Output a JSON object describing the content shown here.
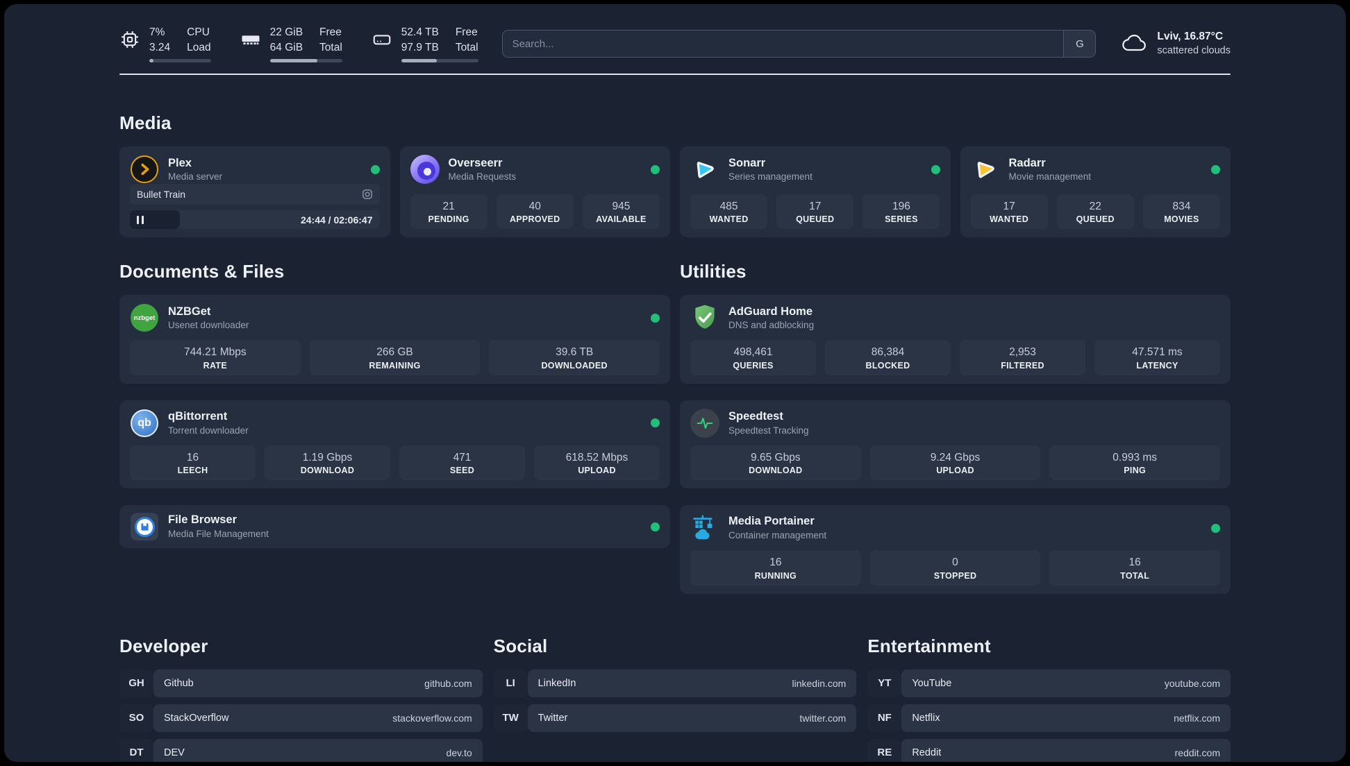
{
  "header": {
    "stats": [
      {
        "id": "cpu",
        "value_top": "7%",
        "value_bottom": "3.24",
        "label_top": "CPU",
        "label_bottom": "Load",
        "progress_percent": 7
      },
      {
        "id": "memory",
        "value_top": "22 GiB",
        "value_bottom": "64 GiB",
        "label_top": "Free",
        "label_bottom": "Total",
        "progress_percent": 66
      },
      {
        "id": "disk",
        "value_top": "52.4 TB",
        "value_bottom": "97.9 TB",
        "label_top": "Free",
        "label_bottom": "Total",
        "progress_percent": 46
      }
    ],
    "search": {
      "placeholder": "Search...",
      "button_label": "G"
    },
    "weather": {
      "location": "Lviv, 16.87°C",
      "condition": "scattered clouds"
    }
  },
  "sections": {
    "media": {
      "title": "Media",
      "plex": {
        "name": "Plex",
        "description": "Media server",
        "status": "online",
        "now_playing": {
          "title": "Bullet Train",
          "state": "paused",
          "time_display": "24:44 / 02:06:47",
          "elapsed": "24:44",
          "duration": "02:06:47",
          "progress_percent": 20
        }
      },
      "overseerr": {
        "name": "Overseerr",
        "description": "Media Requests",
        "status": "online",
        "stats": [
          {
            "value": "21",
            "label": "PENDING"
          },
          {
            "value": "40",
            "label": "APPROVED"
          },
          {
            "value": "945",
            "label": "AVAILABLE"
          }
        ]
      },
      "sonarr": {
        "name": "Sonarr",
        "description": "Series management",
        "status": "online",
        "stats": [
          {
            "value": "485",
            "label": "WANTED"
          },
          {
            "value": "17",
            "label": "QUEUED"
          },
          {
            "value": "196",
            "label": "SERIES"
          }
        ]
      },
      "radarr": {
        "name": "Radarr",
        "description": "Movie management",
        "status": "online",
        "stats": [
          {
            "value": "17",
            "label": "WANTED"
          },
          {
            "value": "22",
            "label": "QUEUED"
          },
          {
            "value": "834",
            "label": "MOVIES"
          }
        ]
      }
    },
    "documents": {
      "title": "Documents & Files",
      "nzbget": {
        "name": "NZBGet",
        "description": "Usenet downloader",
        "status": "online",
        "icon_text": "nzbget",
        "stats": [
          {
            "value": "744.21 Mbps",
            "label": "RATE"
          },
          {
            "value": "266 GB",
            "label": "REMAINING"
          },
          {
            "value": "39.6 TB",
            "label": "DOWNLOADED"
          }
        ]
      },
      "qbittorrent": {
        "name": "qBittorrent",
        "description": "Torrent downloader",
        "status": "online",
        "icon_text": "qb",
        "stats": [
          {
            "value": "16",
            "label": "LEECH"
          },
          {
            "value": "1.19 Gbps",
            "label": "DOWNLOAD"
          },
          {
            "value": "471",
            "label": "SEED"
          },
          {
            "value": "618.52 Mbps",
            "label": "UPLOAD"
          }
        ]
      },
      "filebrowser": {
        "name": "File Browser",
        "description": "Media File Management",
        "status": "online"
      }
    },
    "utilities": {
      "title": "Utilities",
      "adguard": {
        "name": "AdGuard Home",
        "description": "DNS and adblocking",
        "stats": [
          {
            "value": "498,461",
            "label": "QUERIES"
          },
          {
            "value": "86,384",
            "label": "BLOCKED"
          },
          {
            "value": "2,953",
            "label": "FILTERED"
          },
          {
            "value": "47.571 ms",
            "label": "LATENCY"
          }
        ]
      },
      "speedtest": {
        "name": "Speedtest",
        "description": "Speedtest Tracking",
        "stats": [
          {
            "value": "9.65 Gbps",
            "label": "DOWNLOAD"
          },
          {
            "value": "9.24 Gbps",
            "label": "UPLOAD"
          },
          {
            "value": "0.993 ms",
            "label": "PING"
          }
        ]
      },
      "portainer": {
        "name": "Media Portainer",
        "description": "Container management",
        "status": "online",
        "stats": [
          {
            "value": "16",
            "label": "RUNNING"
          },
          {
            "value": "0",
            "label": "STOPPED"
          },
          {
            "value": "16",
            "label": "TOTAL"
          }
        ]
      }
    },
    "bookmarks": {
      "developer": {
        "title": "Developer",
        "links": [
          {
            "abbr": "GH",
            "name": "Github",
            "url": "github.com"
          },
          {
            "abbr": "SO",
            "name": "StackOverflow",
            "url": "stackoverflow.com"
          },
          {
            "abbr": "DT",
            "name": "DEV",
            "url": "dev.to"
          }
        ]
      },
      "social": {
        "title": "Social",
        "links": [
          {
            "abbr": "LI",
            "name": "LinkedIn",
            "url": "linkedin.com"
          },
          {
            "abbr": "TW",
            "name": "Twitter",
            "url": "twitter.com"
          }
        ]
      },
      "entertainment": {
        "title": "Entertainment",
        "links": [
          {
            "abbr": "YT",
            "name": "YouTube",
            "url": "youtube.com"
          },
          {
            "abbr": "NF",
            "name": "Netflix",
            "url": "netflix.com"
          },
          {
            "abbr": "RE",
            "name": "Reddit",
            "url": "reddit.com"
          }
        ]
      }
    }
  },
  "colors": {
    "background": "#1b2231",
    "card": "#252e3e",
    "tile": "#2b3445",
    "status_online": "#21c07a",
    "plex_accent": "#e5a00d",
    "sonarr_accent": "#35c5f4",
    "radarr_accent": "#ffc230",
    "adguard_accent": "#5aab5c",
    "portainer_accent": "#29a9e1"
  }
}
